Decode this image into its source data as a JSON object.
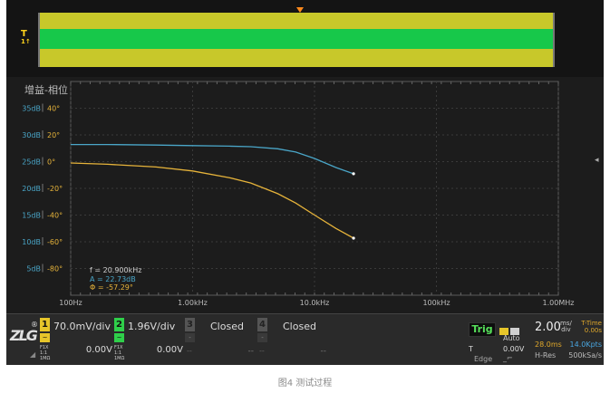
{
  "overview": {
    "marker_label": "T",
    "marker_sub": "1↑"
  },
  "plot": {
    "title": "增益-相位",
    "gain_ticks": [
      "35dB",
      "30dB",
      "25dB",
      "20dB",
      "15dB",
      "10dB",
      "5dB"
    ],
    "phase_ticks": [
      "40°",
      "20°",
      "0°",
      "-20°",
      "-40°",
      "-60°",
      "-80°"
    ],
    "freq_ticks": [
      "100Hz",
      "1.00kHz",
      "10.0kHz",
      "100kHz",
      "1.00MHz"
    ],
    "colors": {
      "gain": "#4aa6c8",
      "phase": "#e6b33a",
      "grid": "#3a3a3a"
    },
    "readouts": {
      "freq": "f = 20.900kHz",
      "gain": "A = 22.73dB",
      "phase": "Φ = -57.29°"
    }
  },
  "chart_data": {
    "type": "line",
    "title": "增益-相位",
    "x_scale": "log",
    "xlim": [
      100,
      1000000
    ],
    "series": [
      {
        "name": "A",
        "axis": "gain-dB",
        "color": "#4aa6c8",
        "x": [
          100,
          200,
          500,
          1000,
          2000,
          3000,
          5000,
          7000,
          10000,
          15000,
          20900
        ],
        "values": [
          28.2,
          28.2,
          28.1,
          28.0,
          27.9,
          27.8,
          27.4,
          26.8,
          25.6,
          23.9,
          22.73
        ]
      },
      {
        "name": "Φ",
        "axis": "phase-deg",
        "color": "#e6b33a",
        "x": [
          100,
          200,
          500,
          1000,
          2000,
          3000,
          5000,
          7000,
          10000,
          15000,
          20900
        ],
        "values": [
          -1,
          -2,
          -4,
          -7,
          -12,
          -16,
          -24,
          -31,
          -40,
          -50,
          -57.29
        ]
      }
    ],
    "gain_ylim": [
      0,
      40
    ],
    "phase_ylim": [
      -100,
      60
    ],
    "grid": true
  },
  "channels": [
    {
      "num": "1",
      "color": "#e6c52a",
      "coupling": "~",
      "meta": [
        "F1X",
        "1:1",
        "1MΩ"
      ],
      "scale": "70.0mV/div",
      "offset": "0.00V"
    },
    {
      "num": "2",
      "color": "#2fcf4a",
      "coupling": "~",
      "meta": [
        "F1X",
        "1:1",
        "1MΩ"
      ],
      "scale": "1.96V/div",
      "offset": "0.00V"
    },
    {
      "num": "3",
      "color": "#555555",
      "coupling": "-",
      "scale": "Closed",
      "placeholder": "--"
    },
    {
      "num": "4",
      "color": "#555555",
      "coupling": "-",
      "scale": "Closed",
      "placeholder": "--"
    }
  ],
  "trigger": {
    "label": "Trig",
    "mode": "Auto",
    "source": "T",
    "level": "0.00V",
    "type": "Edge",
    "slope": "_⌐"
  },
  "timebase": {
    "scale": "2.00",
    "unit_top": "ms/",
    "unit_bottom": "div",
    "ttime_label": "T-Time",
    "ttime_value": "0.00s",
    "position": "28.0ms",
    "points": "14.0Kpts",
    "acq_mode": "H-Res",
    "sample_rate": "500kSa/s"
  },
  "logo": {
    "text": "ZLG",
    "reg": "®"
  },
  "caption": "图4  测试过程"
}
